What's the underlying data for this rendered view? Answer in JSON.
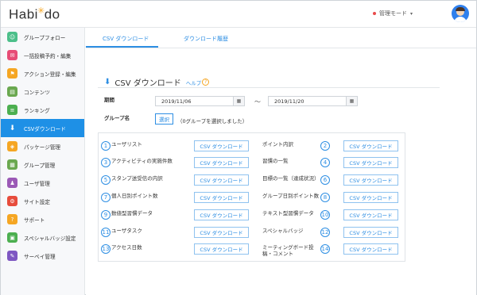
{
  "header": {
    "logo_left": "Habi",
    "logo_star": "✳",
    "logo_right": "do",
    "mode_label": "管理モード",
    "mode_caret": "▾",
    "accent": "#1e90e6"
  },
  "sidebar": {
    "items": [
      {
        "label": "グループフォロー",
        "icon": "follow-icon",
        "color": "#4cbf8a"
      },
      {
        "label": "一括投稿予約・編集",
        "icon": "message-icon",
        "color": "#e74c76"
      },
      {
        "label": "アクション登録・編集",
        "icon": "flag-icon",
        "color": "#f5a623"
      },
      {
        "label": "コンテンツ",
        "icon": "content-icon",
        "color": "#6aa84f"
      },
      {
        "label": "ランキング",
        "icon": "ranking-icon",
        "color": "#4caf50"
      },
      {
        "label": "CSVダウンロード",
        "icon": "download-icon",
        "color": "#1e90e6"
      },
      {
        "label": "パッケージ管理",
        "icon": "package-icon",
        "color": "#f5a623"
      },
      {
        "label": "グループ管理",
        "icon": "group-icon",
        "color": "#6aa84f"
      },
      {
        "label": "ユーザ管理",
        "icon": "user-icon",
        "color": "#9b59b6"
      },
      {
        "label": "サイト設定",
        "icon": "settings-icon",
        "color": "#e74c3c"
      },
      {
        "label": "サポート",
        "icon": "support-icon",
        "color": "#f5a623"
      },
      {
        "label": "スペシャルバッジ設定",
        "icon": "badge-icon",
        "color": "#4caf50"
      },
      {
        "label": "サーベイ管理",
        "icon": "survey-icon",
        "color": "#7e57c2"
      }
    ],
    "active_index": 5
  },
  "tabs": [
    {
      "label": "CSV ダウンロード",
      "active": true
    },
    {
      "label": "ダウンロード履歴",
      "active": false
    }
  ],
  "section": {
    "title": "CSV ダウンロード",
    "help_label": "ヘルプ",
    "period_label": "期間",
    "date_from": "2019/11/06",
    "date_to": "2019/11/20",
    "tilde": "〜",
    "group_label": "グループ名",
    "select_label": "選択",
    "select_note": "（0グループを選択しました）"
  },
  "downloads": {
    "button_label": "CSV ダウンロード",
    "left": [
      {
        "num": "1",
        "label": "ユーザリスト"
      },
      {
        "num": "3",
        "label": "アクティビティの実施件数"
      },
      {
        "num": "5",
        "label": "スタンプ送受信の内訳"
      },
      {
        "num": "7",
        "label": "個人日別ポイント数"
      },
      {
        "num": "9",
        "label": "数値型習慣データ"
      },
      {
        "num": "11",
        "label": "ユーザタスク"
      },
      {
        "num": "13",
        "label": "アクセス日数"
      }
    ],
    "right": [
      {
        "num": "2",
        "label": "ポイント内訳"
      },
      {
        "num": "4",
        "label": "習慣の一覧"
      },
      {
        "num": "6",
        "label": "目標の一覧（達成状況）"
      },
      {
        "num": "8",
        "label": "グループ日別ポイント数"
      },
      {
        "num": "10",
        "label": "テキスト型習慣データ"
      },
      {
        "num": "12",
        "label": "スペシャルバッジ"
      },
      {
        "num": "14",
        "label": "ミーティングボード投稿・コメント"
      }
    ]
  }
}
